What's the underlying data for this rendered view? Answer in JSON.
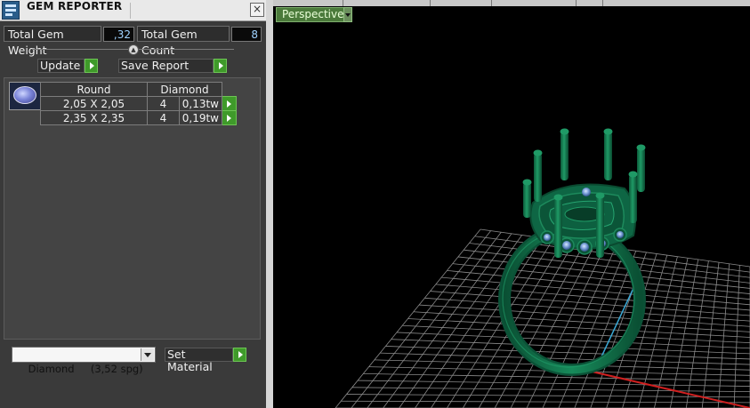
{
  "panel": {
    "title": "GEM REPORTER",
    "close_glyph": "×",
    "total_weight_label": "Total Gem Weight",
    "total_weight_value": ",32",
    "total_count_label": "Total Gem Count",
    "total_count_value": "8",
    "update_label": "Update",
    "save_report_label": "Save Report",
    "table": {
      "shape_header": "Round",
      "material_header": "Diamond",
      "rows": [
        {
          "size": "2,05 X 2,05",
          "count": "4",
          "weight": "0,13tw"
        },
        {
          "size": "2,35 X 2,35",
          "count": "4",
          "weight": "0,19tw"
        }
      ]
    },
    "material_select_value": "Diamond     (3,52 spg)",
    "set_material_label": "Set Material"
  },
  "viewport": {
    "view_name": "Perspective"
  },
  "colors": {
    "model_green": "#0f6a45",
    "grid": "#8a8a8a",
    "axis_blue": "#3aa9d6",
    "axis_red": "#d02020",
    "accent_button_green": "#3f9a2a"
  }
}
